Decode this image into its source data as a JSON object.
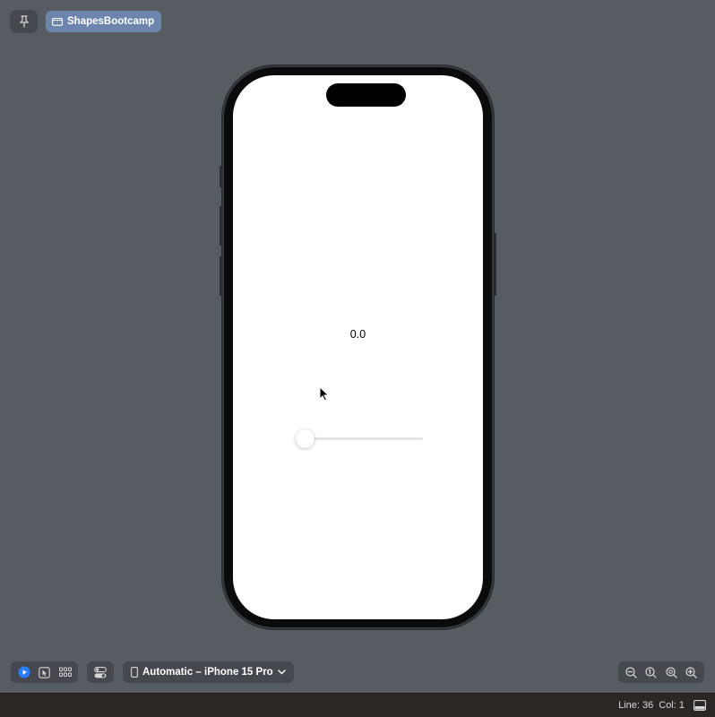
{
  "window": {
    "scheme_label": "ShapesBootcamp"
  },
  "preview": {
    "value_text": "0.0",
    "slider_value": 0.0
  },
  "toolbar": {
    "modes": [
      "live-preview-icon",
      "selectable-icon",
      "variants-grid-icon"
    ],
    "active_mode": "live-preview-icon",
    "device_label": "Automatic – iPhone 15 Pro",
    "zoom": [
      "zoom-out-icon",
      "zoom-actual-icon",
      "zoom-fit-icon",
      "zoom-in-icon"
    ]
  },
  "status": {
    "line": "Line: 36",
    "col": "Col: 1"
  },
  "colors": {
    "canvas": "#575c63",
    "accent": "#2b7cff",
    "chip": "#6b85ac"
  }
}
